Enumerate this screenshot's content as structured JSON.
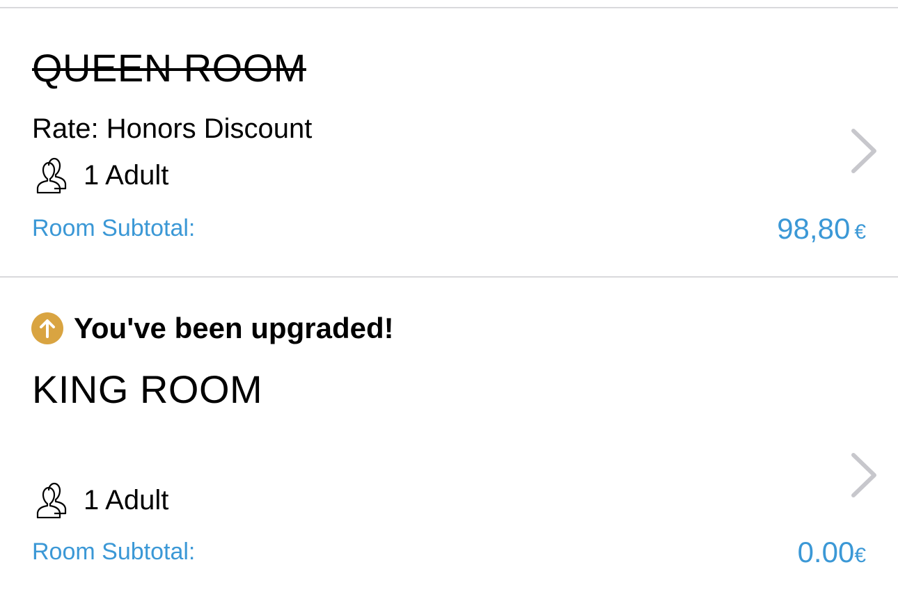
{
  "bookings": [
    {
      "room_name": "QUEEN ROOM",
      "rate": "Rate: Honors Discount",
      "guests": "1 Adult",
      "subtotal_label": "Room Subtotal:",
      "subtotal_amount": "98,80",
      "currency": "€"
    },
    {
      "upgrade_notice": "You've been upgraded!",
      "room_name": "KING ROOM",
      "guests": "1 Adult",
      "subtotal_label": "Room Subtotal:",
      "subtotal_amount": "0.00",
      "currency": "€"
    }
  ],
  "icons": {
    "guests": "guests-icon",
    "chevron": "chevron-right-icon",
    "upgrade": "upgrade-arrow-icon"
  },
  "colors": {
    "accent_blue": "#3b98d6",
    "upgrade_gold": "#d9a441",
    "chevron_gray": "#c7c7cc",
    "divider": "#d9d9dc"
  }
}
